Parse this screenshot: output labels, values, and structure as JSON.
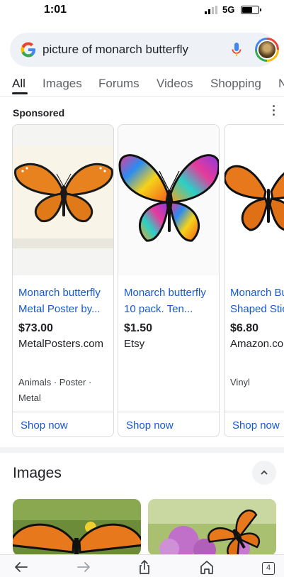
{
  "status_bar": {
    "time": "1:01",
    "network": "5G"
  },
  "search": {
    "query": "picture of monarch butterfly",
    "logo_letter": "G"
  },
  "tabs": [
    {
      "label": "All",
      "active": true
    },
    {
      "label": "Images",
      "active": false
    },
    {
      "label": "Forums",
      "active": false
    },
    {
      "label": "Videos",
      "active": false
    },
    {
      "label": "Shopping",
      "active": false
    },
    {
      "label": "N",
      "active": false
    }
  ],
  "sponsored": {
    "label": "Sponsored",
    "cards": [
      {
        "title_line1": "Monarch butterfly",
        "title_line2": "Metal Poster by...",
        "price": "$73.00",
        "seller": "MetalPosters.com",
        "tags_line1": "Animals · Poster ·",
        "tags_line2": "Metal",
        "cta": "Shop now"
      },
      {
        "title_line1": "Monarch butterfly",
        "title_line2": "10 pack. Ten...",
        "price": "$1.50",
        "seller": "Etsy",
        "tags_line1": "",
        "tags_line2": "",
        "cta": "Shop now"
      },
      {
        "title_line1": "Monarch Bu",
        "title_line2": "Shaped Stic",
        "price": "$6.80",
        "seller": "Amazon.co",
        "tags_line1": "Vinyl",
        "tags_line2": "",
        "cta": "Shop now"
      }
    ]
  },
  "images_section": {
    "heading": "Images"
  },
  "toolbar": {
    "tab_count": "4"
  },
  "colors": {
    "link_blue": "#1558d6",
    "monarch_orange": "#e8781c",
    "search_bg": "#eef2f6"
  }
}
